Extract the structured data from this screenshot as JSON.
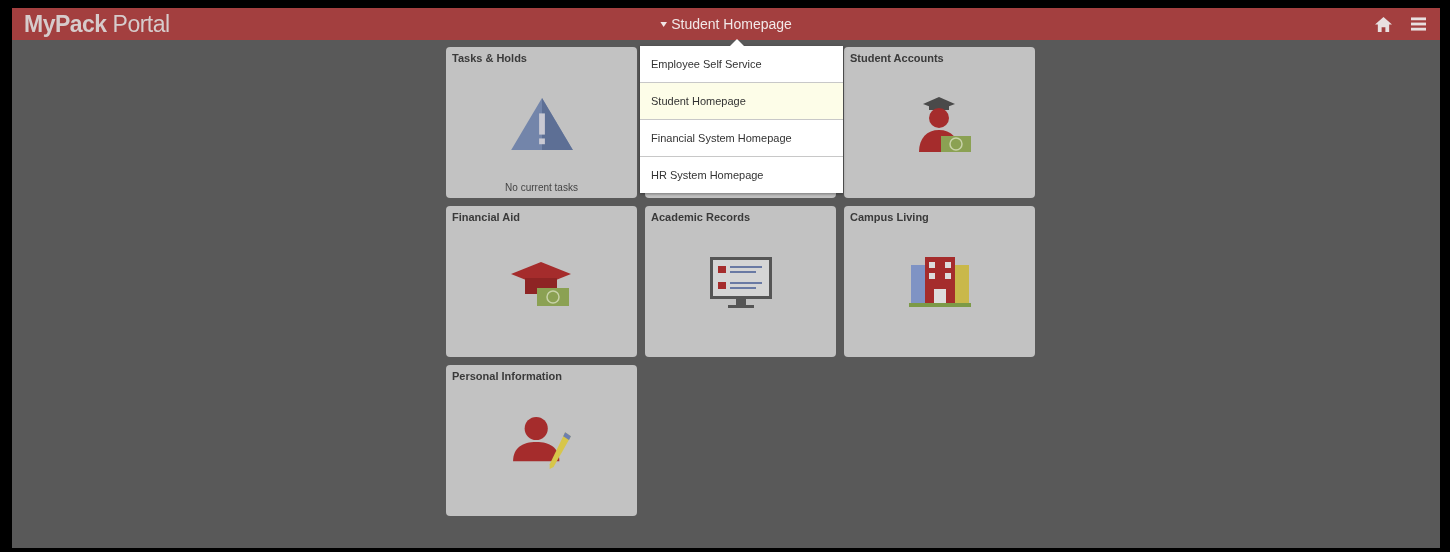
{
  "header": {
    "brand_bold": "MyPack",
    "brand_light": "Portal",
    "homepage_menu": {
      "label": "Student Homepage",
      "expanded": true
    }
  },
  "homepage_options": [
    {
      "label": "Employee Self Service",
      "selected": false
    },
    {
      "label": "Student Homepage",
      "selected": true
    },
    {
      "label": "Financial System Homepage",
      "selected": false
    },
    {
      "label": "HR System Homepage",
      "selected": false
    }
  ],
  "tiles": [
    {
      "title": "Tasks & Holds",
      "note": "No current tasks"
    },
    {
      "hidden": true
    },
    {
      "title": "Student Accounts"
    },
    {
      "title": "Financial Aid"
    },
    {
      "title": "Academic Records"
    },
    {
      "title": "Campus Living"
    },
    {
      "title": "Personal Information"
    }
  ]
}
